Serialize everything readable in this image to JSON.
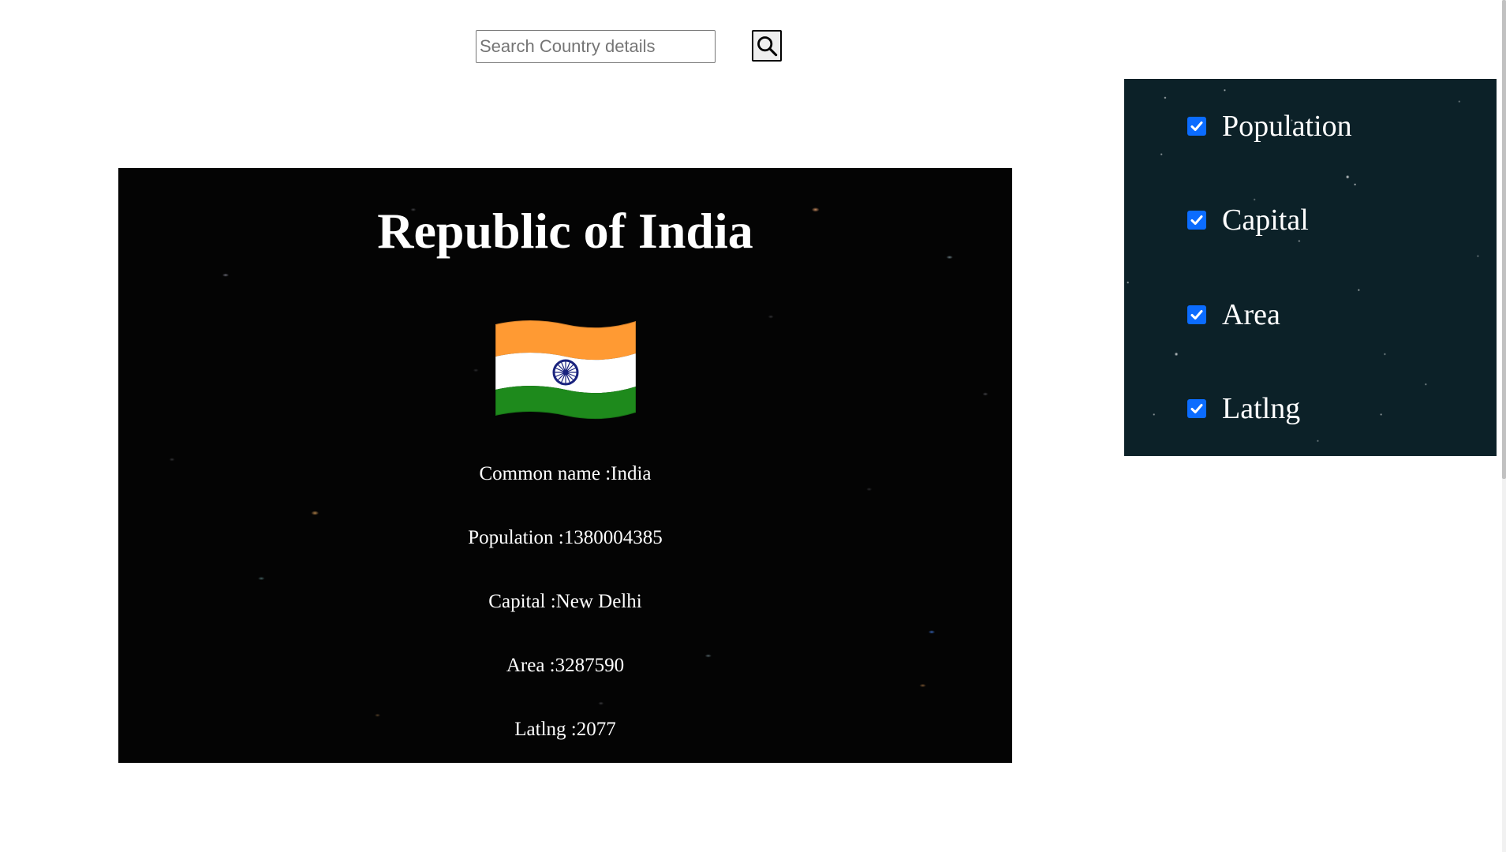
{
  "search": {
    "placeholder": "Search Country details",
    "value": "",
    "button_icon": "search-icon"
  },
  "country": {
    "official_name": "Republic of India",
    "flag_icon": "india-flag-icon",
    "details": [
      {
        "label": "Common name",
        "value": "India",
        "text": "Common name :India"
      },
      {
        "label": "Population",
        "value": "1380004385",
        "text": "Population :1380004385"
      },
      {
        "label": "Capital",
        "value": "New Delhi",
        "text": "Capital :New Delhi"
      },
      {
        "label": "Area",
        "value": "3287590",
        "text": "Area :3287590"
      },
      {
        "label": "Latlng",
        "value": "2077",
        "text": "Latlng :2077"
      }
    ]
  },
  "filters": [
    {
      "label": "Population",
      "checked": true
    },
    {
      "label": "Capital",
      "checked": true
    },
    {
      "label": "Area",
      "checked": true
    },
    {
      "label": "Latlng",
      "checked": true
    }
  ],
  "colors": {
    "card_background": "#040404",
    "panel_background": "#0c2128",
    "checkbox_accent": "#0b6cff",
    "text_on_dark": "#ffffff"
  }
}
